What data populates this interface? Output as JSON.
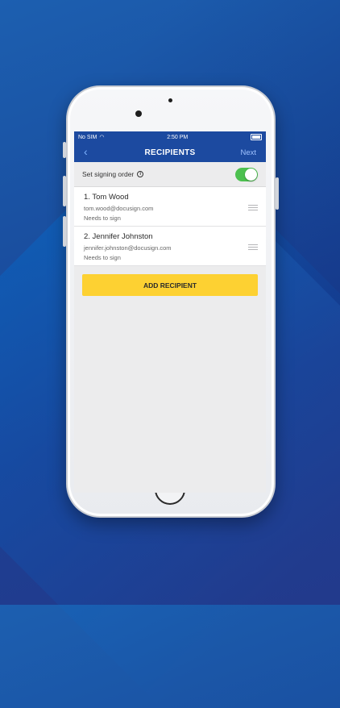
{
  "status_bar": {
    "carrier": "No SIM",
    "time": "2:50 PM"
  },
  "nav": {
    "back_icon": "chevron-left-icon",
    "title": "RECIPIENTS",
    "next_label": "Next"
  },
  "signing_order": {
    "label": "Set signing order",
    "info_icon": "info-icon",
    "enabled": true
  },
  "recipients": [
    {
      "name": "1. Tom Wood",
      "email": "tom.wood@docusign.com",
      "status": "Needs to sign"
    },
    {
      "name": "2. Jennifer Johnston",
      "email": "jennifer.johnston@docusign.com",
      "status": "Needs to sign"
    }
  ],
  "add_recipient_label": "ADD RECIPIENT",
  "colors": {
    "nav_bar": "#1c4aa0",
    "toggle_on": "#4cc04f",
    "add_button": "#fdd132"
  }
}
